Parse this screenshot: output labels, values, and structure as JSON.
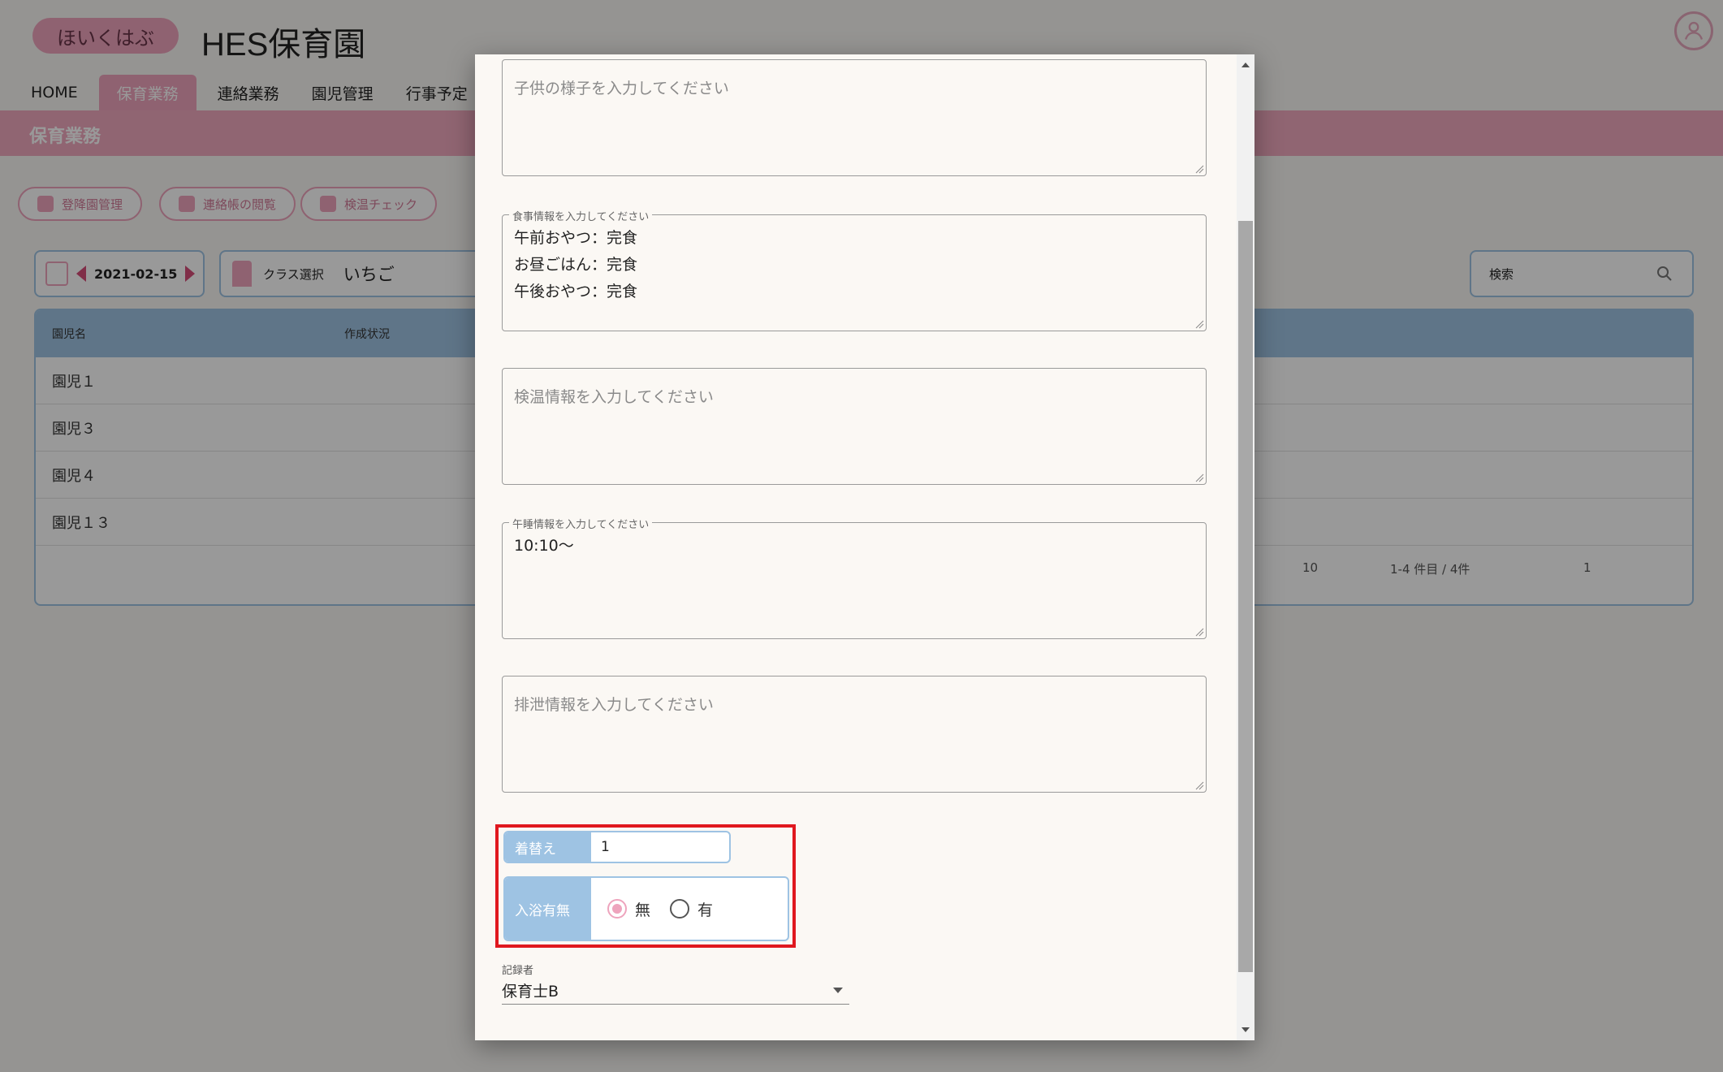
{
  "app": {
    "logo_text": "ほいくはぶ",
    "title": "HES保育園"
  },
  "nav": {
    "items": [
      {
        "label": "HOME"
      },
      {
        "label": "保育業務"
      },
      {
        "label": "連絡業務"
      },
      {
        "label": "園児管理"
      },
      {
        "label": "行事予定"
      }
    ],
    "active_index": 1
  },
  "subbar": {
    "title": "保育業務"
  },
  "actions": [
    {
      "label": "登降園管理"
    },
    {
      "label": "連絡帳の閲覧"
    },
    {
      "label": "検温チェック"
    }
  ],
  "filters": {
    "date": "2021-02-15",
    "class_label": "クラス選択",
    "class_value": "いちご",
    "search_placeholder": "検索"
  },
  "table": {
    "headers": [
      "園児名",
      "作成状況"
    ],
    "rows": [
      "園児１",
      "園児３",
      "園児４",
      "園児１３"
    ]
  },
  "pager": {
    "per_page": "10",
    "range": "1-4 件目 / 4件",
    "page": "1"
  },
  "dialog": {
    "child_note_placeholder": "子供の様子を入力してください",
    "meal": {
      "legend": "食事情報を入力してください",
      "lines": [
        "午前おやつ：完食",
        "お昼ごはん：完食",
        "午後おやつ：完食"
      ]
    },
    "temp_placeholder": "検温情報を入力してください",
    "nap": {
      "legend": "午睡情報を入力してください",
      "value": "10:10～"
    },
    "excretion_placeholder": "排泄情報を入力してください",
    "changing": {
      "label": "着替え",
      "value": "1"
    },
    "bath": {
      "label": "入浴有無",
      "options": [
        "無",
        "有"
      ],
      "selected": "無"
    },
    "recorder": {
      "label": "記録者",
      "value": "保育士B"
    }
  },
  "colors": {
    "accent_pink": "#eea4bd",
    "accent_blue": "#9ec3e3",
    "highlight_red": "#e0181f"
  }
}
